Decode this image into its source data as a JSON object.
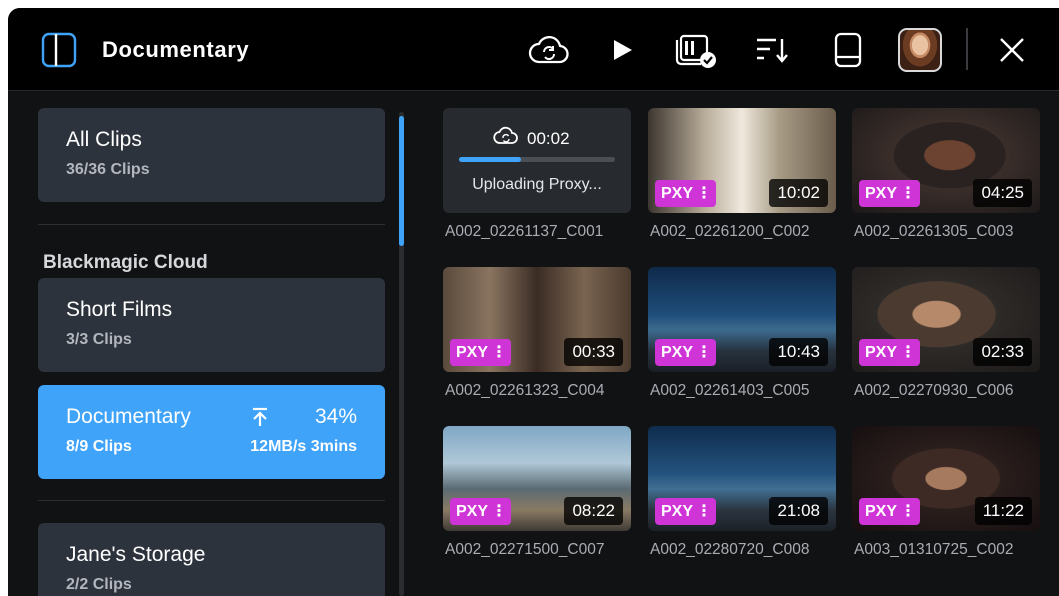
{
  "header": {
    "project_title": "Documentary"
  },
  "sidebar": {
    "all_clips": {
      "title": "All Clips",
      "count": "36/36 Clips"
    },
    "section_label": "Blackmagic Cloud",
    "projects": [
      {
        "title": "Short Films",
        "count": "3/3 Clips"
      },
      {
        "title": "Documentary",
        "count": "8/9 Clips",
        "upload_percent": "34%",
        "upload_rate": "12MB/s 3mins",
        "upload_progress": 0.34
      }
    ],
    "storage": {
      "title": "Jane's Storage",
      "count": "2/2 Clips"
    }
  },
  "clips": [
    {
      "name": "A002_02261137_C001",
      "status": "uploading",
      "upload_time": "00:02",
      "upload_label": "Uploading Proxy...",
      "upload_progress": 0.4
    },
    {
      "name": "A002_02261200_C002",
      "badge": "PXY",
      "duration": "10:02"
    },
    {
      "name": "A002_02261305_C003",
      "badge": "PXY",
      "duration": "04:25"
    },
    {
      "name": "A002_02261323_C004",
      "badge": "PXY",
      "duration": "00:33"
    },
    {
      "name": "A002_02261403_C005",
      "badge": "PXY",
      "duration": "10:43"
    },
    {
      "name": "A002_02270930_C006",
      "badge": "PXY",
      "duration": "02:33"
    },
    {
      "name": "A002_02271500_C007",
      "badge": "PXY",
      "duration": "08:22"
    },
    {
      "name": "A002_02280720_C008",
      "badge": "PXY",
      "duration": "21:08"
    },
    {
      "name": "A003_01310725_C002",
      "badge": "PXY",
      "duration": "11:22"
    }
  ],
  "colors": {
    "accent": "#3fa3f9",
    "proxy_badge": "#cf35d6",
    "card": "#2d333d",
    "header_bg": "#000000"
  },
  "icons": {
    "header": [
      "sidebar-toggle-icon",
      "cloud-sync-icon",
      "play-icon",
      "media-check-icon",
      "sort-icon",
      "drive-icon",
      "avatar",
      "close-icon"
    ],
    "upload": "upload-arrow-icon",
    "proxy_menu": "more-vertical-icon"
  }
}
